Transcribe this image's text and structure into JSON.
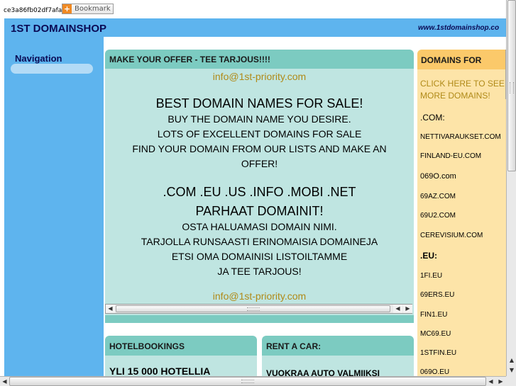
{
  "top": {
    "id_text": "ce3a86fb02df7afa",
    "bookmark_label": "Bookmark",
    "bookmark_icon": "+"
  },
  "header": {
    "title": "1ST DOMAINSHOP",
    "url": "www.1stdomainshop.co"
  },
  "nav": {
    "title": "Navigation"
  },
  "offer": {
    "heading": "MAKE YOUR OFFER - TEE TARJOUS!!!!",
    "email_top": "info@1st-priority.com",
    "lines": [
      "BEST DOMAIN NAMES FOR SALE!",
      "BUY THE DOMAIN NAME YOU DESIRE.",
      "LOTS OF EXCELLENT DOMAINS FOR SALE",
      "FIND YOUR DOMAIN FROM OUR LISTS AND MAKE AN",
      "OFFER!",
      ".COM .EU .US .INFO .MOBI .NET",
      "PARHAAT DOMAINIT!",
      "OSTA HALUAMASI DOMAIN NIMI.",
      "TARJOLLA RUNSAASTI ERINOMAISIA DOMAINEJA",
      "ETSI OMA DOMAINISI LISTOILTAMME",
      "JA TEE TARJOUS!"
    ],
    "email_bottom": "info@1st-priority.com"
  },
  "hotel": {
    "heading": "HOTELBOOKINGS",
    "body": "YLI 15 000 HOTELLIA"
  },
  "car": {
    "heading": "RENT A CAR:",
    "body": "VUOKRAA AUTO VALMIIKSI"
  },
  "domains": {
    "heading": "DOMAINS FOR",
    "link_line1": "CLICK HERE TO SEE",
    "link_line2": "MORE DOMAINS!",
    "com_label": ".COM:",
    "com_items": [
      "NETTIVARAUKSET.COM",
      "FINLAND-EU.COM",
      "069O.com",
      "69AZ.COM",
      "69U2.COM",
      "CEREVISIUM.COM"
    ],
    "eu_label": ".EU:",
    "eu_items": [
      "1FI.EU",
      "69ERS.EU",
      "FIN1.EU",
      "MC69.EU",
      "1STFIN.EU",
      "069O.EU"
    ]
  },
  "colors": {
    "header_blue": "#5eb4ee",
    "panel_teal": "#bfe5e1",
    "panel_head_teal": "#7ccbc1",
    "domains_bg": "#fde4a8",
    "domains_head": "#fbc96a",
    "link_gold": "#b08a18"
  }
}
